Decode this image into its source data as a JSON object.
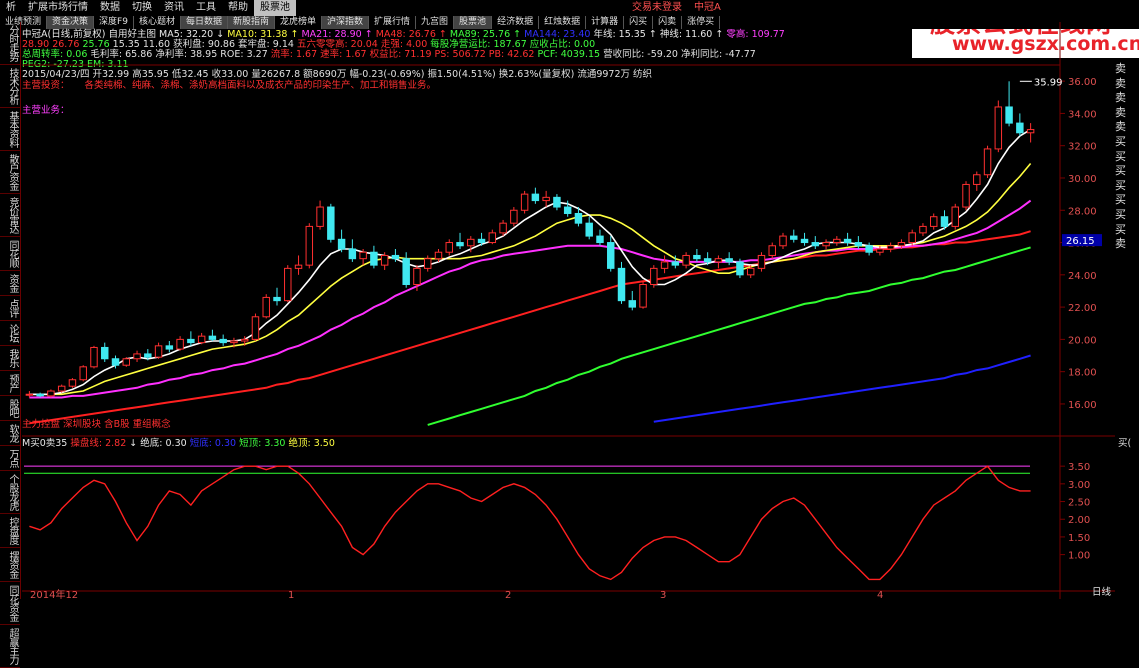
{
  "menu": [
    "析",
    "扩展市场行情",
    "数据",
    "切换",
    "资讯",
    "工具",
    "帮助",
    "股票池",
    "交易未登录",
    "中冠A"
  ],
  "toolbar": [
    "业绩预测",
    "资金决策",
    "深度F9",
    "核心题材",
    "每日数据",
    "新股指南",
    "龙虎榜单",
    "沪深指数",
    "扩展行情",
    "九宫图",
    "股票池",
    "经济数据",
    "红烛数据",
    "计算器",
    "闪买",
    "闪卖",
    "涨停买"
  ],
  "side_tabs": [
    "分时走势",
    "技术分析",
    "基本资料",
    "散户资金",
    "竞价雷达",
    "同花顺",
    "资金",
    "点评",
    "论坛",
    "我乐",
    "预产",
    "股吧",
    "软龙",
    "万点",
    "个股龙虎",
    "控盘度",
    "摆资金",
    "同花资金",
    "超赢主力"
  ],
  "right_tabs": [
    "卖",
    "卖",
    "卖",
    "卖",
    "卖",
    "买",
    "买",
    "买",
    "买",
    "买",
    "买",
    "买",
    "卖"
  ],
  "logo": {
    "line1": "股票公式在线网",
    "line2": "www.gszx.com.cn"
  },
  "header": {
    "line1": {
      "name": "中冠A(日线,前复权)",
      "template": "自用好主图",
      "ma5": "MA5: 32.20",
      "ma10": "MA10: 31.38",
      "ma21": "MA21: 28.90",
      "ma48": "MA48: 26.76",
      "ma89": "MA89: 25.76",
      "ma144": "MA144: 23.40",
      "year": "年线: 15.35",
      "shen": "神线: 11.60",
      "zero": "零高: 109.77"
    },
    "line2": [
      "28.90",
      "26.76",
      "25.76",
      "15.35",
      "11.60",
      "获利盘: 90.86",
      "套牢盘: 9.14",
      "五六零零高: 20.04",
      "走强: 4.00",
      "每股净营运比: 187.67",
      "应收占比: 0.00"
    ],
    "line3": [
      "总周转率: 0.06",
      "毛利率: 65.86",
      "净利率: 38.95",
      "ROE: 3.27",
      "流率: 1.67",
      "速率: 1.67",
      "权益比: 71.19",
      "PS: 506.72",
      "PB: 42.62",
      "PCF: 4039.15",
      "营收同比: -59.20",
      "净利同比: -47.77"
    ],
    "line4": [
      "PEG2: -27.23",
      "EM: 3.11"
    ],
    "line5": "2015/04/23/四 开32.99 高35.95 低32.45 收33.00 量26267.8 额8690万 幅-0.23(-0.69%) 振1.50(4.51%) 换2.63%(量复权) 流通9972万 纺织",
    "main_note_label": "主营投资：",
    "main_note": "各类纯棉、纯麻、涤棉、涤奶高档面料以及成衣产品的印染生产、加工和销售业务。",
    "main_biz_label": "主营业务："
  },
  "bottom_tags": [
    "主力控盘",
    "深圳股块",
    "含B股",
    "重组概念"
  ],
  "ind_header": {
    "name": "M买0卖35",
    "a": "操盘线: 2.82",
    "b": "绝底: 0.30",
    "c": "短底: 0.30",
    "d": "短顶: 3.30",
    "e": "绝顶: 3.50"
  },
  "price_label": "26.15",
  "max_label": "35.99",
  "x_labels": [
    "2014年12",
    "1",
    "2",
    "3",
    "4"
  ],
  "period_label": "日线",
  "right_corner": "买(",
  "chart_data": {
    "type": "candlestick",
    "y_ticks": [
      16.0,
      18.0,
      20.0,
      22.0,
      24.0,
      26.0,
      28.0,
      30.0,
      32.0,
      34.0,
      36.0
    ],
    "ylim": [
      14.2,
      37.0
    ],
    "ind_ticks": [
      1.0,
      1.5,
      2.0,
      2.5,
      3.0,
      3.5
    ],
    "ind_ylim": [
      0.0,
      3.9
    ],
    "ind_lines": [
      3.5,
      3.3
    ],
    "candles": [
      [
        16.6,
        16.8,
        16.4,
        16.6
      ],
      [
        16.6,
        16.7,
        16.4,
        16.5
      ],
      [
        16.5,
        16.9,
        16.4,
        16.8
      ],
      [
        16.8,
        17.2,
        16.7,
        17.1
      ],
      [
        17.1,
        17.6,
        17.0,
        17.5
      ],
      [
        17.5,
        18.4,
        17.4,
        18.3
      ],
      [
        18.3,
        19.6,
        18.2,
        19.5
      ],
      [
        19.5,
        19.8,
        18.6,
        18.8
      ],
      [
        18.8,
        19.0,
        18.2,
        18.4
      ],
      [
        18.4,
        18.9,
        18.3,
        18.8
      ],
      [
        18.8,
        19.3,
        18.6,
        19.1
      ],
      [
        19.1,
        19.4,
        18.7,
        18.9
      ],
      [
        18.9,
        19.8,
        18.8,
        19.6
      ],
      [
        19.6,
        19.9,
        19.2,
        19.4
      ],
      [
        19.4,
        20.2,
        19.3,
        20.0
      ],
      [
        20.0,
        20.5,
        19.6,
        19.8
      ],
      [
        19.8,
        20.4,
        19.7,
        20.2
      ],
      [
        20.2,
        20.6,
        19.9,
        20.0
      ],
      [
        20.0,
        20.3,
        19.6,
        19.8
      ],
      [
        19.8,
        20.1,
        19.5,
        19.9
      ],
      [
        19.9,
        20.2,
        19.6,
        20.0
      ],
      [
        20.0,
        21.6,
        19.9,
        21.4
      ],
      [
        21.4,
        22.8,
        21.3,
        22.6
      ],
      [
        22.6,
        23.2,
        22.1,
        22.4
      ],
      [
        22.4,
        24.6,
        22.3,
        24.4
      ],
      [
        24.4,
        25.2,
        24.0,
        24.6
      ],
      [
        24.6,
        27.2,
        24.4,
        27.0
      ],
      [
        27.0,
        28.6,
        26.8,
        28.2
      ],
      [
        28.2,
        28.4,
        26.0,
        26.2
      ],
      [
        26.2,
        26.8,
        25.4,
        25.6
      ],
      [
        25.6,
        26.2,
        24.8,
        25.0
      ],
      [
        25.0,
        25.6,
        24.6,
        25.4
      ],
      [
        25.4,
        25.8,
        24.4,
        24.6
      ],
      [
        24.6,
        25.4,
        24.3,
        25.2
      ],
      [
        25.2,
        25.6,
        24.8,
        25.0
      ],
      [
        25.0,
        25.4,
        23.2,
        23.4
      ],
      [
        23.4,
        24.6,
        23.0,
        24.4
      ],
      [
        24.4,
        25.2,
        24.2,
        25.0
      ],
      [
        25.0,
        25.6,
        24.8,
        25.4
      ],
      [
        25.4,
        26.2,
        25.2,
        26.0
      ],
      [
        26.0,
        26.6,
        25.6,
        25.8
      ],
      [
        25.8,
        26.4,
        25.4,
        26.2
      ],
      [
        26.2,
        26.6,
        25.8,
        26.0
      ],
      [
        26.0,
        26.8,
        25.9,
        26.6
      ],
      [
        26.6,
        27.4,
        26.4,
        27.2
      ],
      [
        27.2,
        28.2,
        27.0,
        28.0
      ],
      [
        28.0,
        29.2,
        27.8,
        29.0
      ],
      [
        29.0,
        29.4,
        28.4,
        28.6
      ],
      [
        28.6,
        29.2,
        28.2,
        28.8
      ],
      [
        28.8,
        29.0,
        28.0,
        28.2
      ],
      [
        28.2,
        28.6,
        27.6,
        27.8
      ],
      [
        27.8,
        28.2,
        27.0,
        27.2
      ],
      [
        27.2,
        27.6,
        26.2,
        26.4
      ],
      [
        26.4,
        26.8,
        25.8,
        26.0
      ],
      [
        26.0,
        26.4,
        24.2,
        24.4
      ],
      [
        24.4,
        24.8,
        22.2,
        22.4
      ],
      [
        22.4,
        23.0,
        21.8,
        22.0
      ],
      [
        22.0,
        23.6,
        21.9,
        23.4
      ],
      [
        23.4,
        24.6,
        23.2,
        24.4
      ],
      [
        24.4,
        25.2,
        24.1,
        24.8
      ],
      [
        24.8,
        25.2,
        24.4,
        24.6
      ],
      [
        24.6,
        25.4,
        24.4,
        25.2
      ],
      [
        25.2,
        25.6,
        24.8,
        25.0
      ],
      [
        25.0,
        25.4,
        24.6,
        24.8
      ],
      [
        24.8,
        25.2,
        24.4,
        25.0
      ],
      [
        25.0,
        25.4,
        24.6,
        24.8
      ],
      [
        24.8,
        25.0,
        23.8,
        24.0
      ],
      [
        24.0,
        24.6,
        23.8,
        24.4
      ],
      [
        24.4,
        25.4,
        24.2,
        25.2
      ],
      [
        25.2,
        26.0,
        25.0,
        25.8
      ],
      [
        25.8,
        26.6,
        25.6,
        26.4
      ],
      [
        26.4,
        26.8,
        26.0,
        26.2
      ],
      [
        26.2,
        26.6,
        25.8,
        26.0
      ],
      [
        26.0,
        26.4,
        25.6,
        25.8
      ],
      [
        25.8,
        26.2,
        25.6,
        26.0
      ],
      [
        26.0,
        26.4,
        25.8,
        26.2
      ],
      [
        26.2,
        26.6,
        25.8,
        26.0
      ],
      [
        26.0,
        26.4,
        25.6,
        25.8
      ],
      [
        25.8,
        26.0,
        25.2,
        25.4
      ],
      [
        25.4,
        25.8,
        25.2,
        25.6
      ],
      [
        25.6,
        26.0,
        25.4,
        25.8
      ],
      [
        25.8,
        26.2,
        25.6,
        26.0
      ],
      [
        26.0,
        26.8,
        25.8,
        26.6
      ],
      [
        26.6,
        27.2,
        26.4,
        27.0
      ],
      [
        27.0,
        27.8,
        26.8,
        27.6
      ],
      [
        27.6,
        28.0,
        26.8,
        27.0
      ],
      [
        27.0,
        28.4,
        26.8,
        28.2
      ],
      [
        28.2,
        29.8,
        28.0,
        29.6
      ],
      [
        29.6,
        30.4,
        29.2,
        30.2
      ],
      [
        30.2,
        32.0,
        30.0,
        31.8
      ],
      [
        31.8,
        34.8,
        31.6,
        34.4
      ],
      [
        34.4,
        35.99,
        33.2,
        33.4
      ],
      [
        33.4,
        34.0,
        32.6,
        32.8
      ],
      [
        32.8,
        33.4,
        32.2,
        33.0
      ]
    ],
    "ma5": [
      16.6,
      16.6,
      16.6,
      16.7,
      16.9,
      17.2,
      17.7,
      18.1,
      18.4,
      18.8,
      18.9,
      18.8,
      18.9,
      19.1,
      19.4,
      19.6,
      19.8,
      19.9,
      19.9,
      19.9,
      20.0,
      20.4,
      21.0,
      21.5,
      22.2,
      22.9,
      23.7,
      24.6,
      25.3,
      25.6,
      25.6,
      25.4,
      25.3,
      25.2,
      25.0,
      24.7,
      24.5,
      24.6,
      24.8,
      25.1,
      25.3,
      25.6,
      25.9,
      26.1,
      26.4,
      26.9,
      27.4,
      27.8,
      28.2,
      28.5,
      28.4,
      28.1,
      27.7,
      27.1,
      26.5,
      25.5,
      24.5,
      23.8,
      23.4,
      23.4,
      23.7,
      24.1,
      24.6,
      24.7,
      24.9,
      24.9,
      24.7,
      24.6,
      24.6,
      24.8,
      25.1,
      25.4,
      25.6,
      25.9,
      26.0,
      26.0,
      26.0,
      25.9,
      25.8,
      25.7,
      25.7,
      25.8,
      25.9,
      26.1,
      26.6,
      26.9,
      27.4,
      27.9,
      28.7,
      29.6,
      30.9,
      31.9,
      32.6,
      33.0
    ],
    "ma10": [
      16.6,
      16.6,
      16.6,
      16.6,
      16.7,
      16.8,
      17.1,
      17.4,
      17.6,
      17.8,
      18.0,
      18.2,
      18.4,
      18.6,
      18.8,
      19.0,
      19.2,
      19.4,
      19.5,
      19.6,
      19.7,
      19.9,
      20.2,
      20.6,
      21.1,
      21.5,
      22.1,
      22.7,
      23.3,
      23.8,
      24.2,
      24.6,
      24.9,
      25.0,
      25.1,
      25.0,
      25.0,
      25.0,
      25.0,
      25.0,
      25.0,
      25.1,
      25.2,
      25.4,
      25.6,
      25.8,
      26.1,
      26.4,
      26.8,
      27.2,
      27.4,
      27.6,
      27.7,
      27.7,
      27.5,
      27.2,
      26.8,
      26.3,
      25.8,
      25.4,
      25.0,
      24.8,
      24.5,
      24.3,
      24.1,
      24.1,
      24.3,
      24.5,
      24.7,
      24.8,
      24.9,
      25.0,
      25.2,
      25.4,
      25.5,
      25.6,
      25.7,
      25.8,
      25.8,
      25.8,
      25.8,
      25.8,
      25.9,
      26.0,
      26.2,
      26.4,
      26.7,
      27.0,
      27.4,
      27.9,
      28.6,
      29.4,
      30.1,
      30.9
    ],
    "ma21": [
      16.4,
      16.4,
      16.4,
      16.4,
      16.5,
      16.5,
      16.6,
      16.7,
      16.8,
      16.9,
      17.0,
      17.2,
      17.3,
      17.5,
      17.6,
      17.8,
      17.9,
      18.1,
      18.2,
      18.4,
      18.5,
      18.7,
      18.9,
      19.1,
      19.4,
      19.6,
      19.9,
      20.2,
      20.6,
      20.9,
      21.3,
      21.6,
      22.0,
      22.3,
      22.7,
      23.0,
      23.3,
      23.6,
      23.9,
      24.2,
      24.4,
      24.7,
      24.9,
      25.0,
      25.2,
      25.3,
      25.4,
      25.5,
      25.6,
      25.7,
      25.8,
      25.8,
      25.8,
      25.8,
      25.7,
      25.6,
      25.4,
      25.2,
      25.0,
      24.9,
      24.8,
      24.8,
      24.8,
      24.8,
      24.8,
      24.8,
      24.8,
      24.9,
      24.9,
      25.0,
      25.1,
      25.2,
      25.3,
      25.4,
      25.5,
      25.5,
      25.6,
      25.6,
      25.6,
      25.7,
      25.7,
      25.7,
      25.8,
      25.8,
      25.9,
      26.0,
      26.2,
      26.4,
      26.6,
      26.9,
      27.3,
      27.7,
      28.1,
      28.6
    ],
    "ma48": [
      14.8,
      14.9,
      15.0,
      15.1,
      15.2,
      15.3,
      15.4,
      15.5,
      15.6,
      15.7,
      15.8,
      15.9,
      16.0,
      16.1,
      16.2,
      16.3,
      16.4,
      16.5,
      16.6,
      16.7,
      16.8,
      16.9,
      17.0,
      17.2,
      17.3,
      17.5,
      17.6,
      17.8,
      18.0,
      18.2,
      18.4,
      18.6,
      18.8,
      19.0,
      19.2,
      19.4,
      19.6,
      19.8,
      20.0,
      20.2,
      20.4,
      20.6,
      20.8,
      21.0,
      21.2,
      21.4,
      21.6,
      21.8,
      22.0,
      22.2,
      22.4,
      22.6,
      22.8,
      23.0,
      23.2,
      23.4,
      23.5,
      23.6,
      23.7,
      23.8,
      23.9,
      24.0,
      24.1,
      24.2,
      24.3,
      24.4,
      24.5,
      24.6,
      24.7,
      24.8,
      24.9,
      25.0,
      25.1,
      25.2,
      25.2,
      25.3,
      25.4,
      25.5,
      25.5,
      25.6,
      25.6,
      25.7,
      25.7,
      25.8,
      25.9,
      25.9,
      26.0,
      26.0,
      26.1,
      26.2,
      26.3,
      26.4,
      26.5,
      26.7
    ],
    "ma89": [
      null,
      null,
      null,
      null,
      null,
      null,
      null,
      null,
      null,
      null,
      null,
      null,
      null,
      null,
      null,
      null,
      null,
      null,
      null,
      null,
      null,
      null,
      null,
      null,
      null,
      null,
      null,
      null,
      null,
      null,
      null,
      null,
      null,
      null,
      null,
      null,
      null,
      14.7,
      14.9,
      15.1,
      15.3,
      15.5,
      15.7,
      15.9,
      16.1,
      16.3,
      16.5,
      16.8,
      17.0,
      17.3,
      17.5,
      17.8,
      18.0,
      18.3,
      18.5,
      18.8,
      19.0,
      19.2,
      19.4,
      19.6,
      19.8,
      20.0,
      20.2,
      20.4,
      20.6,
      20.8,
      21.0,
      21.2,
      21.4,
      21.6,
      21.8,
      22.0,
      22.2,
      22.3,
      22.5,
      22.6,
      22.8,
      22.9,
      23.0,
      23.2,
      23.4,
      23.5,
      23.7,
      23.8,
      24.0,
      24.2,
      24.3,
      24.5,
      24.7,
      24.9,
      25.1,
      25.3,
      25.5,
      25.7
    ],
    "ma144": [
      null,
      null,
      null,
      null,
      null,
      null,
      null,
      null,
      null,
      null,
      null,
      null,
      null,
      null,
      null,
      null,
      null,
      null,
      null,
      null,
      null,
      null,
      null,
      null,
      null,
      null,
      null,
      null,
      null,
      null,
      null,
      null,
      null,
      null,
      null,
      null,
      null,
      null,
      null,
      null,
      null,
      null,
      null,
      null,
      null,
      null,
      null,
      null,
      null,
      null,
      null,
      null,
      null,
      null,
      null,
      null,
      null,
      null,
      14.9,
      15.0,
      15.1,
      15.2,
      15.3,
      15.4,
      15.5,
      15.6,
      15.7,
      15.8,
      15.9,
      16.0,
      16.1,
      16.2,
      16.3,
      16.4,
      16.5,
      16.6,
      16.7,
      16.8,
      16.9,
      17.0,
      17.1,
      17.2,
      17.3,
      17.4,
      17.5,
      17.6,
      17.8,
      17.9,
      18.1,
      18.2,
      18.4,
      18.6,
      18.8,
      19.0
    ],
    "ind": [
      1.8,
      1.7,
      1.9,
      2.3,
      2.6,
      2.9,
      3.1,
      3.0,
      2.5,
      1.9,
      1.4,
      1.8,
      2.4,
      2.8,
      2.7,
      2.4,
      2.8,
      3.0,
      3.2,
      3.4,
      3.5,
      3.5,
      3.4,
      3.5,
      3.5,
      3.3,
      3.0,
      2.6,
      2.2,
      1.8,
      1.2,
      1.0,
      1.3,
      1.8,
      2.2,
      2.5,
      2.8,
      3.0,
      3.0,
      2.9,
      2.8,
      2.6,
      2.5,
      2.7,
      2.9,
      3.0,
      2.9,
      2.7,
      2.4,
      2.0,
      1.5,
      1.0,
      0.6,
      0.4,
      0.3,
      0.5,
      0.9,
      1.2,
      1.4,
      1.5,
      1.5,
      1.4,
      1.2,
      1.0,
      0.8,
      0.8,
      1.0,
      1.5,
      2.0,
      2.3,
      2.5,
      2.6,
      2.4,
      2.0,
      1.6,
      1.2,
      0.9,
      0.6,
      0.3,
      0.3,
      0.6,
      1.0,
      1.5,
      2.0,
      2.4,
      2.6,
      2.8,
      3.1,
      3.3,
      3.5,
      3.1,
      2.9,
      2.8,
      2.8
    ]
  }
}
